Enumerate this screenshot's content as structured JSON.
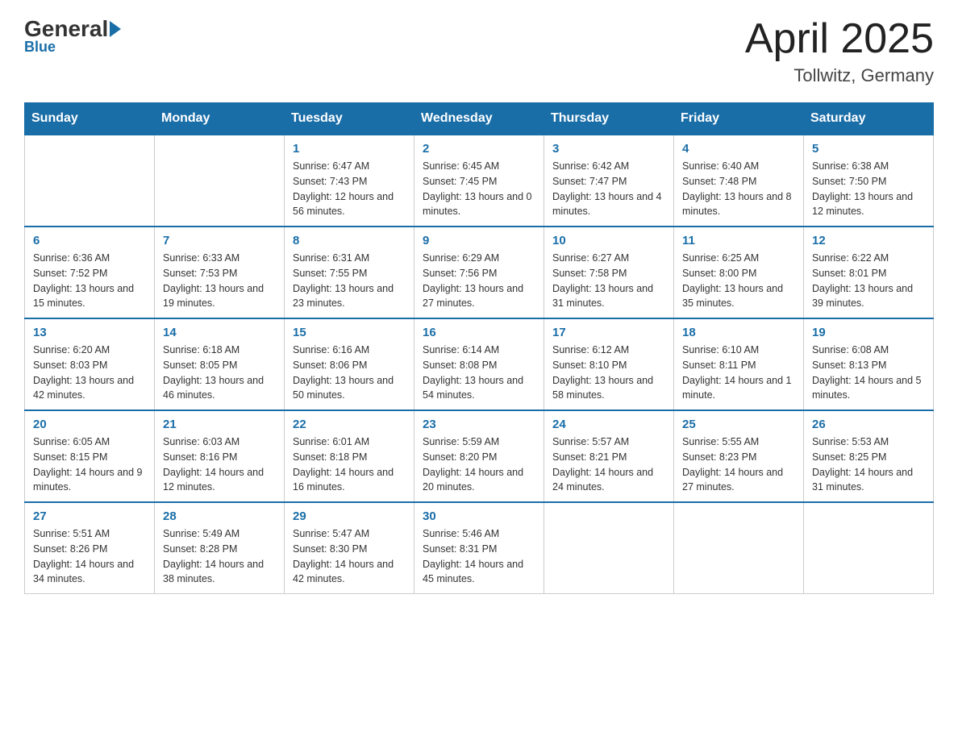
{
  "logo": {
    "name_part1": "General",
    "name_part2": "Blue"
  },
  "header": {
    "title": "April 2025",
    "location": "Tollwitz, Germany"
  },
  "days_of_week": [
    "Sunday",
    "Monday",
    "Tuesday",
    "Wednesday",
    "Thursday",
    "Friday",
    "Saturday"
  ],
  "weeks": [
    [
      {
        "day": "",
        "info": ""
      },
      {
        "day": "",
        "info": ""
      },
      {
        "day": "1",
        "info": "Sunrise: 6:47 AM\nSunset: 7:43 PM\nDaylight: 12 hours\nand 56 minutes."
      },
      {
        "day": "2",
        "info": "Sunrise: 6:45 AM\nSunset: 7:45 PM\nDaylight: 13 hours\nand 0 minutes."
      },
      {
        "day": "3",
        "info": "Sunrise: 6:42 AM\nSunset: 7:47 PM\nDaylight: 13 hours\nand 4 minutes."
      },
      {
        "day": "4",
        "info": "Sunrise: 6:40 AM\nSunset: 7:48 PM\nDaylight: 13 hours\nand 8 minutes."
      },
      {
        "day": "5",
        "info": "Sunrise: 6:38 AM\nSunset: 7:50 PM\nDaylight: 13 hours\nand 12 minutes."
      }
    ],
    [
      {
        "day": "6",
        "info": "Sunrise: 6:36 AM\nSunset: 7:52 PM\nDaylight: 13 hours\nand 15 minutes."
      },
      {
        "day": "7",
        "info": "Sunrise: 6:33 AM\nSunset: 7:53 PM\nDaylight: 13 hours\nand 19 minutes."
      },
      {
        "day": "8",
        "info": "Sunrise: 6:31 AM\nSunset: 7:55 PM\nDaylight: 13 hours\nand 23 minutes."
      },
      {
        "day": "9",
        "info": "Sunrise: 6:29 AM\nSunset: 7:56 PM\nDaylight: 13 hours\nand 27 minutes."
      },
      {
        "day": "10",
        "info": "Sunrise: 6:27 AM\nSunset: 7:58 PM\nDaylight: 13 hours\nand 31 minutes."
      },
      {
        "day": "11",
        "info": "Sunrise: 6:25 AM\nSunset: 8:00 PM\nDaylight: 13 hours\nand 35 minutes."
      },
      {
        "day": "12",
        "info": "Sunrise: 6:22 AM\nSunset: 8:01 PM\nDaylight: 13 hours\nand 39 minutes."
      }
    ],
    [
      {
        "day": "13",
        "info": "Sunrise: 6:20 AM\nSunset: 8:03 PM\nDaylight: 13 hours\nand 42 minutes."
      },
      {
        "day": "14",
        "info": "Sunrise: 6:18 AM\nSunset: 8:05 PM\nDaylight: 13 hours\nand 46 minutes."
      },
      {
        "day": "15",
        "info": "Sunrise: 6:16 AM\nSunset: 8:06 PM\nDaylight: 13 hours\nand 50 minutes."
      },
      {
        "day": "16",
        "info": "Sunrise: 6:14 AM\nSunset: 8:08 PM\nDaylight: 13 hours\nand 54 minutes."
      },
      {
        "day": "17",
        "info": "Sunrise: 6:12 AM\nSunset: 8:10 PM\nDaylight: 13 hours\nand 58 minutes."
      },
      {
        "day": "18",
        "info": "Sunrise: 6:10 AM\nSunset: 8:11 PM\nDaylight: 14 hours\nand 1 minute."
      },
      {
        "day": "19",
        "info": "Sunrise: 6:08 AM\nSunset: 8:13 PM\nDaylight: 14 hours\nand 5 minutes."
      }
    ],
    [
      {
        "day": "20",
        "info": "Sunrise: 6:05 AM\nSunset: 8:15 PM\nDaylight: 14 hours\nand 9 minutes."
      },
      {
        "day": "21",
        "info": "Sunrise: 6:03 AM\nSunset: 8:16 PM\nDaylight: 14 hours\nand 12 minutes."
      },
      {
        "day": "22",
        "info": "Sunrise: 6:01 AM\nSunset: 8:18 PM\nDaylight: 14 hours\nand 16 minutes."
      },
      {
        "day": "23",
        "info": "Sunrise: 5:59 AM\nSunset: 8:20 PM\nDaylight: 14 hours\nand 20 minutes."
      },
      {
        "day": "24",
        "info": "Sunrise: 5:57 AM\nSunset: 8:21 PM\nDaylight: 14 hours\nand 24 minutes."
      },
      {
        "day": "25",
        "info": "Sunrise: 5:55 AM\nSunset: 8:23 PM\nDaylight: 14 hours\nand 27 minutes."
      },
      {
        "day": "26",
        "info": "Sunrise: 5:53 AM\nSunset: 8:25 PM\nDaylight: 14 hours\nand 31 minutes."
      }
    ],
    [
      {
        "day": "27",
        "info": "Sunrise: 5:51 AM\nSunset: 8:26 PM\nDaylight: 14 hours\nand 34 minutes."
      },
      {
        "day": "28",
        "info": "Sunrise: 5:49 AM\nSunset: 8:28 PM\nDaylight: 14 hours\nand 38 minutes."
      },
      {
        "day": "29",
        "info": "Sunrise: 5:47 AM\nSunset: 8:30 PM\nDaylight: 14 hours\nand 42 minutes."
      },
      {
        "day": "30",
        "info": "Sunrise: 5:46 AM\nSunset: 8:31 PM\nDaylight: 14 hours\nand 45 minutes."
      },
      {
        "day": "",
        "info": ""
      },
      {
        "day": "",
        "info": ""
      },
      {
        "day": "",
        "info": ""
      }
    ]
  ]
}
